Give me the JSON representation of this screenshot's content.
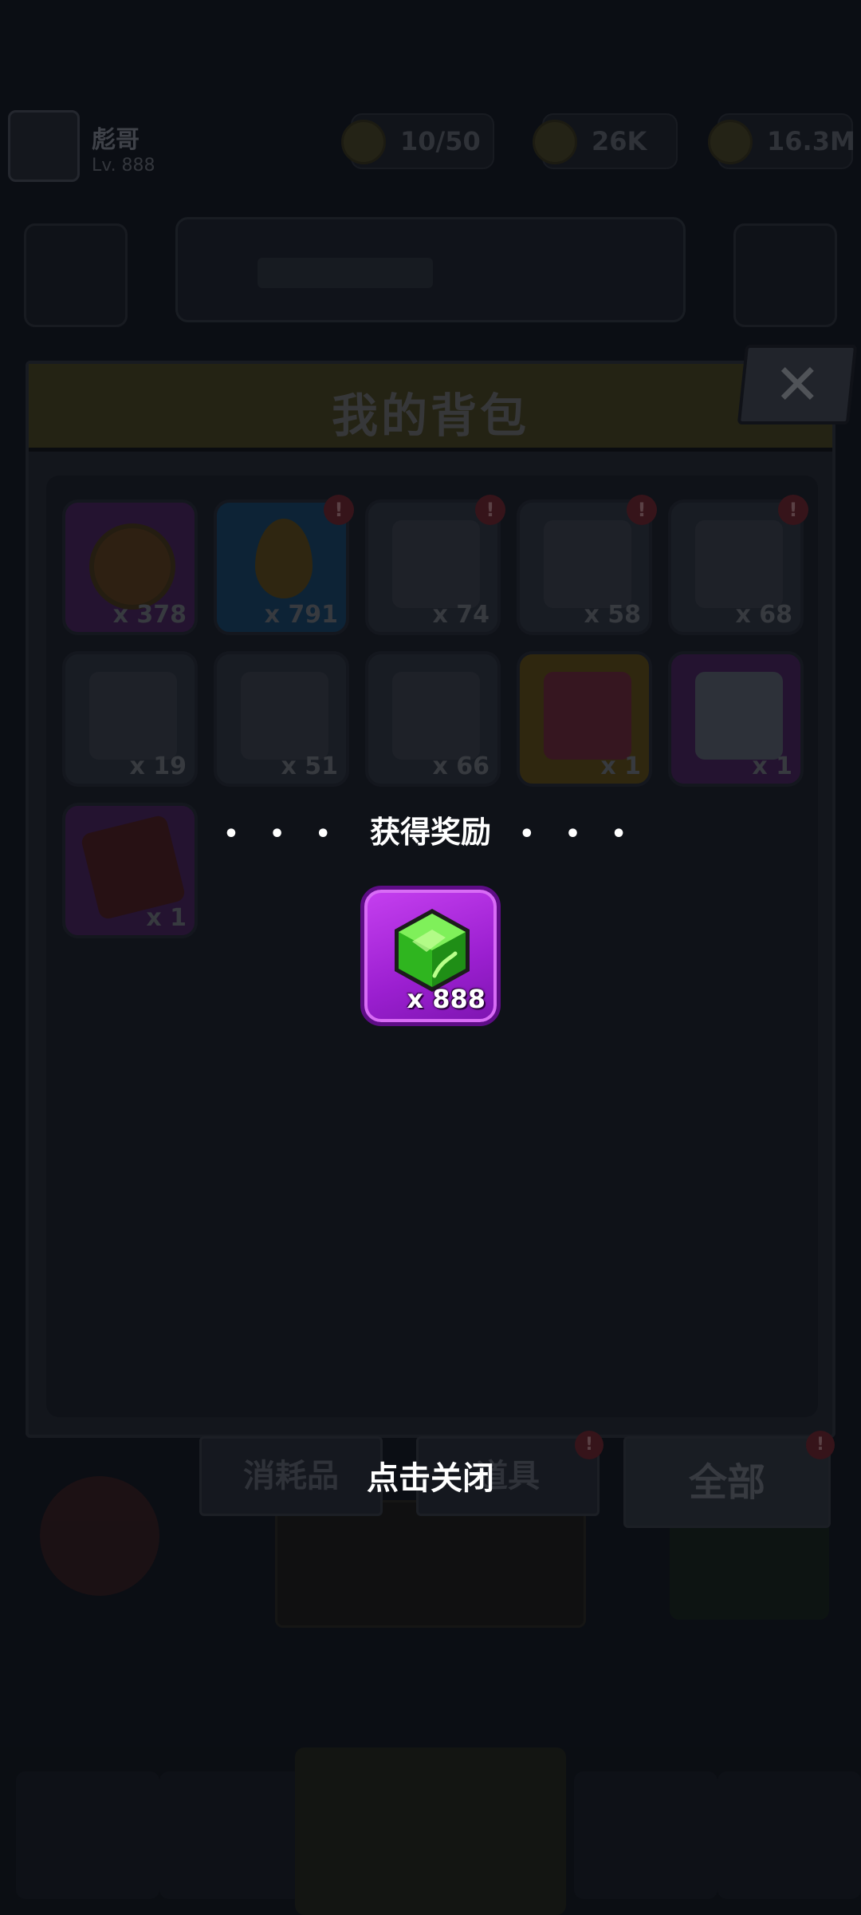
{
  "background": {
    "player_name": "彪哥",
    "player_sub": "Lv. 888",
    "resources": [
      {
        "name": "energy",
        "value": "10/50"
      },
      {
        "name": "gold",
        "value": "26K"
      },
      {
        "name": "coins",
        "value": "16.3M"
      }
    ]
  },
  "panel": {
    "title": "我的背包",
    "items": [
      {
        "icon": "heart-icon",
        "count": "x 378",
        "style": "purple",
        "alert": false
      },
      {
        "icon": "flame-drop-icon",
        "count": "x 791",
        "style": "blue",
        "alert": true
      },
      {
        "icon": "gun-scroll-icon",
        "count": "x 74",
        "style": "gray",
        "alert": true
      },
      {
        "icon": "shirt-scroll-icon",
        "count": "x 58",
        "style": "gray",
        "alert": true
      },
      {
        "icon": "necklace-scroll-icon",
        "count": "x 68",
        "style": "gray",
        "alert": true
      },
      {
        "icon": "belt-scroll-icon",
        "count": "x 19",
        "style": "gray",
        "alert": false
      },
      {
        "icon": "glove-scroll-icon",
        "count": "x 51",
        "style": "gray",
        "alert": false
      },
      {
        "icon": "boot-scroll-icon",
        "count": "x 66",
        "style": "gray",
        "alert": false
      },
      {
        "icon": "gold-chest-icon",
        "count": "x 1",
        "style": "gold",
        "alert": false
      },
      {
        "icon": "purple-chest-icon",
        "count": "x 1",
        "style": "purple",
        "alert": false
      },
      {
        "icon": "book-icon",
        "count": "x 1",
        "style": "purple",
        "alert": false
      }
    ],
    "alert_mark": "!"
  },
  "tabs": [
    {
      "label": "消耗品",
      "alert": false
    },
    {
      "label": "道具",
      "alert": true
    },
    {
      "label": "全部",
      "alert": true,
      "active": true
    }
  ],
  "reward": {
    "title": "获得奖励",
    "dots_left": "• • •",
    "dots_right": "• • •",
    "item_icon": "green-gem-icon",
    "item_count": "x 888",
    "gem_color": "#3ccf2b"
  },
  "close_hint": "点击关闭",
  "close_symbol": "✕"
}
